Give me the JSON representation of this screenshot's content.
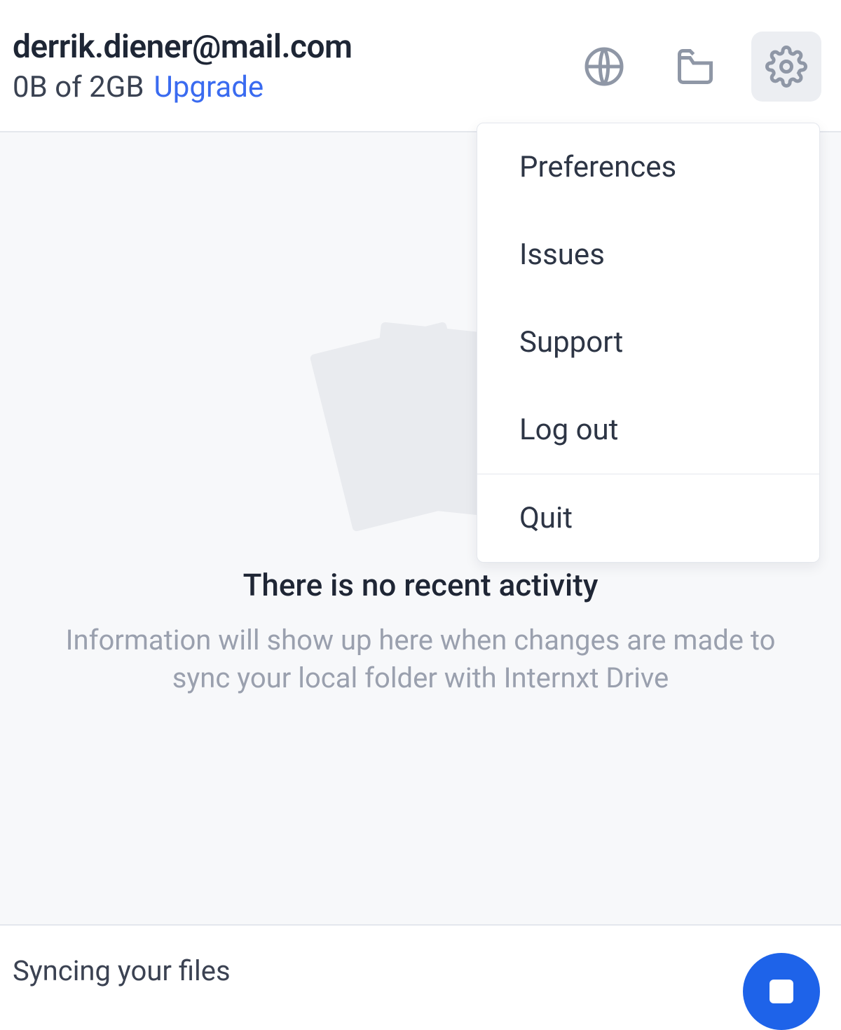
{
  "header": {
    "email": "derrik.diener@mail.com",
    "storage_text": "0B of 2GB",
    "upgrade_label": "Upgrade"
  },
  "icons": {
    "globe": "globe-icon",
    "folder": "folder-icon",
    "gear": "gear-icon"
  },
  "menu": {
    "items": [
      "Preferences",
      "Issues",
      "Support",
      "Log out"
    ],
    "quit": "Quit"
  },
  "empty_state": {
    "title": "There is no recent activity",
    "subtitle": "Information will show up here when changes are made to sync your local folder with Internxt Drive"
  },
  "footer": {
    "status": "Syncing your files"
  },
  "colors": {
    "link": "#3a6bf0",
    "accent": "#1e63e9"
  }
}
